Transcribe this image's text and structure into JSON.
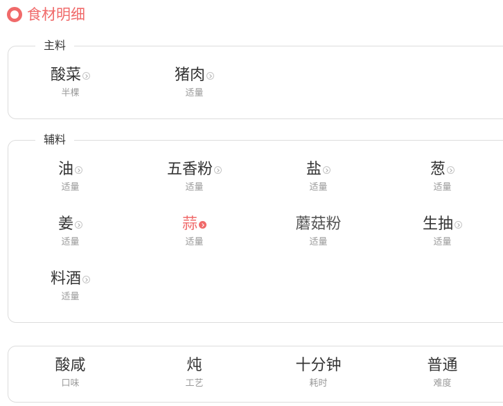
{
  "header": {
    "title": "食材明细"
  },
  "main_ingredients": {
    "legend": "主料",
    "items": [
      {
        "name": "酸菜",
        "qty": "半棵"
      },
      {
        "name": "猪肉",
        "qty": "适量"
      }
    ]
  },
  "aux_ingredients": {
    "legend": "辅料",
    "items": [
      {
        "name": "油",
        "qty": "适量"
      },
      {
        "name": "五香粉",
        "qty": "适量"
      },
      {
        "name": "盐",
        "qty": "适量"
      },
      {
        "name": "葱",
        "qty": "适量"
      },
      {
        "name": "姜",
        "qty": "适量"
      },
      {
        "name": "蒜",
        "qty": "适量"
      },
      {
        "name": "蘑菇粉",
        "qty": "适量"
      },
      {
        "name": "生抽",
        "qty": "适量"
      },
      {
        "name": "料酒",
        "qty": "适量"
      }
    ]
  },
  "recipe_info": [
    {
      "value": "酸咸",
      "label": "口味"
    },
    {
      "value": "炖",
      "label": "工艺"
    },
    {
      "value": "十分钟",
      "label": "耗时"
    },
    {
      "value": "普通",
      "label": "难度"
    }
  ],
  "colors": {
    "accent": "#f06a6a",
    "text": "#333333",
    "muted": "#999999",
    "border": "#dcdcdc"
  },
  "icons": {
    "header": "ring-icon",
    "item_link": "chevron-right-circle-icon"
  }
}
